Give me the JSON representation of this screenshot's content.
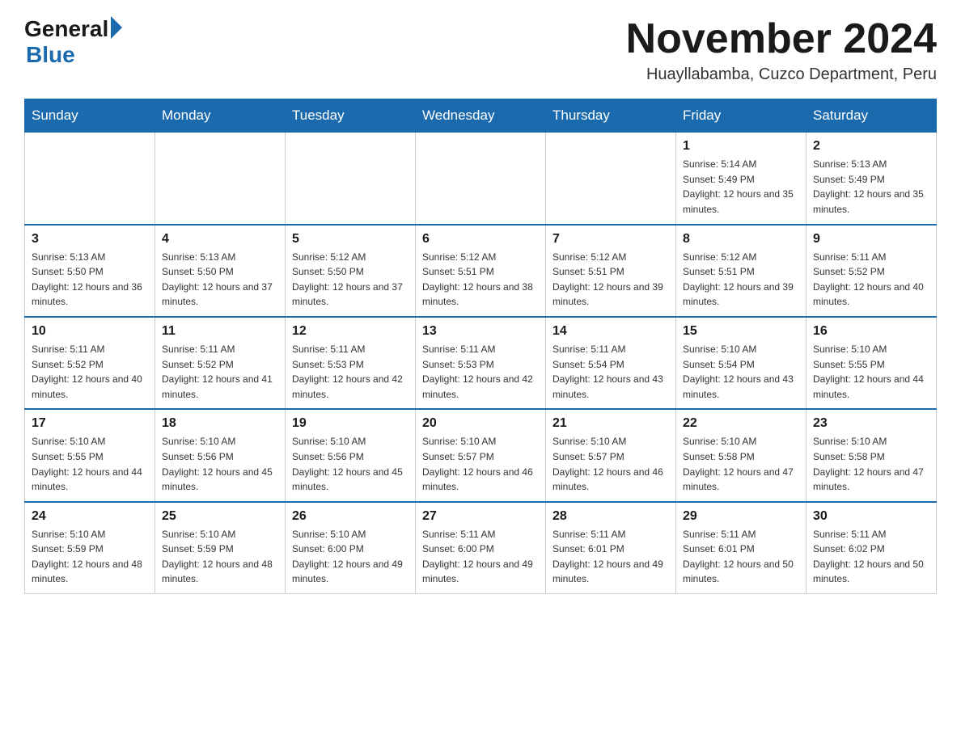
{
  "logo": {
    "general": "General",
    "blue": "Blue"
  },
  "title": "November 2024",
  "location": "Huayllabamba, Cuzco Department, Peru",
  "days_of_week": [
    "Sunday",
    "Monday",
    "Tuesday",
    "Wednesday",
    "Thursday",
    "Friday",
    "Saturday"
  ],
  "weeks": [
    [
      {
        "day": "",
        "sunrise": "",
        "sunset": "",
        "daylight": ""
      },
      {
        "day": "",
        "sunrise": "",
        "sunset": "",
        "daylight": ""
      },
      {
        "day": "",
        "sunrise": "",
        "sunset": "",
        "daylight": ""
      },
      {
        "day": "",
        "sunrise": "",
        "sunset": "",
        "daylight": ""
      },
      {
        "day": "",
        "sunrise": "",
        "sunset": "",
        "daylight": ""
      },
      {
        "day": "1",
        "sunrise": "Sunrise: 5:14 AM",
        "sunset": "Sunset: 5:49 PM",
        "daylight": "Daylight: 12 hours and 35 minutes."
      },
      {
        "day": "2",
        "sunrise": "Sunrise: 5:13 AM",
        "sunset": "Sunset: 5:49 PM",
        "daylight": "Daylight: 12 hours and 35 minutes."
      }
    ],
    [
      {
        "day": "3",
        "sunrise": "Sunrise: 5:13 AM",
        "sunset": "Sunset: 5:50 PM",
        "daylight": "Daylight: 12 hours and 36 minutes."
      },
      {
        "day": "4",
        "sunrise": "Sunrise: 5:13 AM",
        "sunset": "Sunset: 5:50 PM",
        "daylight": "Daylight: 12 hours and 37 minutes."
      },
      {
        "day": "5",
        "sunrise": "Sunrise: 5:12 AM",
        "sunset": "Sunset: 5:50 PM",
        "daylight": "Daylight: 12 hours and 37 minutes."
      },
      {
        "day": "6",
        "sunrise": "Sunrise: 5:12 AM",
        "sunset": "Sunset: 5:51 PM",
        "daylight": "Daylight: 12 hours and 38 minutes."
      },
      {
        "day": "7",
        "sunrise": "Sunrise: 5:12 AM",
        "sunset": "Sunset: 5:51 PM",
        "daylight": "Daylight: 12 hours and 39 minutes."
      },
      {
        "day": "8",
        "sunrise": "Sunrise: 5:12 AM",
        "sunset": "Sunset: 5:51 PM",
        "daylight": "Daylight: 12 hours and 39 minutes."
      },
      {
        "day": "9",
        "sunrise": "Sunrise: 5:11 AM",
        "sunset": "Sunset: 5:52 PM",
        "daylight": "Daylight: 12 hours and 40 minutes."
      }
    ],
    [
      {
        "day": "10",
        "sunrise": "Sunrise: 5:11 AM",
        "sunset": "Sunset: 5:52 PM",
        "daylight": "Daylight: 12 hours and 40 minutes."
      },
      {
        "day": "11",
        "sunrise": "Sunrise: 5:11 AM",
        "sunset": "Sunset: 5:52 PM",
        "daylight": "Daylight: 12 hours and 41 minutes."
      },
      {
        "day": "12",
        "sunrise": "Sunrise: 5:11 AM",
        "sunset": "Sunset: 5:53 PM",
        "daylight": "Daylight: 12 hours and 42 minutes."
      },
      {
        "day": "13",
        "sunrise": "Sunrise: 5:11 AM",
        "sunset": "Sunset: 5:53 PM",
        "daylight": "Daylight: 12 hours and 42 minutes."
      },
      {
        "day": "14",
        "sunrise": "Sunrise: 5:11 AM",
        "sunset": "Sunset: 5:54 PM",
        "daylight": "Daylight: 12 hours and 43 minutes."
      },
      {
        "day": "15",
        "sunrise": "Sunrise: 5:10 AM",
        "sunset": "Sunset: 5:54 PM",
        "daylight": "Daylight: 12 hours and 43 minutes."
      },
      {
        "day": "16",
        "sunrise": "Sunrise: 5:10 AM",
        "sunset": "Sunset: 5:55 PM",
        "daylight": "Daylight: 12 hours and 44 minutes."
      }
    ],
    [
      {
        "day": "17",
        "sunrise": "Sunrise: 5:10 AM",
        "sunset": "Sunset: 5:55 PM",
        "daylight": "Daylight: 12 hours and 44 minutes."
      },
      {
        "day": "18",
        "sunrise": "Sunrise: 5:10 AM",
        "sunset": "Sunset: 5:56 PM",
        "daylight": "Daylight: 12 hours and 45 minutes."
      },
      {
        "day": "19",
        "sunrise": "Sunrise: 5:10 AM",
        "sunset": "Sunset: 5:56 PM",
        "daylight": "Daylight: 12 hours and 45 minutes."
      },
      {
        "day": "20",
        "sunrise": "Sunrise: 5:10 AM",
        "sunset": "Sunset: 5:57 PM",
        "daylight": "Daylight: 12 hours and 46 minutes."
      },
      {
        "day": "21",
        "sunrise": "Sunrise: 5:10 AM",
        "sunset": "Sunset: 5:57 PM",
        "daylight": "Daylight: 12 hours and 46 minutes."
      },
      {
        "day": "22",
        "sunrise": "Sunrise: 5:10 AM",
        "sunset": "Sunset: 5:58 PM",
        "daylight": "Daylight: 12 hours and 47 minutes."
      },
      {
        "day": "23",
        "sunrise": "Sunrise: 5:10 AM",
        "sunset": "Sunset: 5:58 PM",
        "daylight": "Daylight: 12 hours and 47 minutes."
      }
    ],
    [
      {
        "day": "24",
        "sunrise": "Sunrise: 5:10 AM",
        "sunset": "Sunset: 5:59 PM",
        "daylight": "Daylight: 12 hours and 48 minutes."
      },
      {
        "day": "25",
        "sunrise": "Sunrise: 5:10 AM",
        "sunset": "Sunset: 5:59 PM",
        "daylight": "Daylight: 12 hours and 48 minutes."
      },
      {
        "day": "26",
        "sunrise": "Sunrise: 5:10 AM",
        "sunset": "Sunset: 6:00 PM",
        "daylight": "Daylight: 12 hours and 49 minutes."
      },
      {
        "day": "27",
        "sunrise": "Sunrise: 5:11 AM",
        "sunset": "Sunset: 6:00 PM",
        "daylight": "Daylight: 12 hours and 49 minutes."
      },
      {
        "day": "28",
        "sunrise": "Sunrise: 5:11 AM",
        "sunset": "Sunset: 6:01 PM",
        "daylight": "Daylight: 12 hours and 49 minutes."
      },
      {
        "day": "29",
        "sunrise": "Sunrise: 5:11 AM",
        "sunset": "Sunset: 6:01 PM",
        "daylight": "Daylight: 12 hours and 50 minutes."
      },
      {
        "day": "30",
        "sunrise": "Sunrise: 5:11 AM",
        "sunset": "Sunset: 6:02 PM",
        "daylight": "Daylight: 12 hours and 50 minutes."
      }
    ]
  ]
}
